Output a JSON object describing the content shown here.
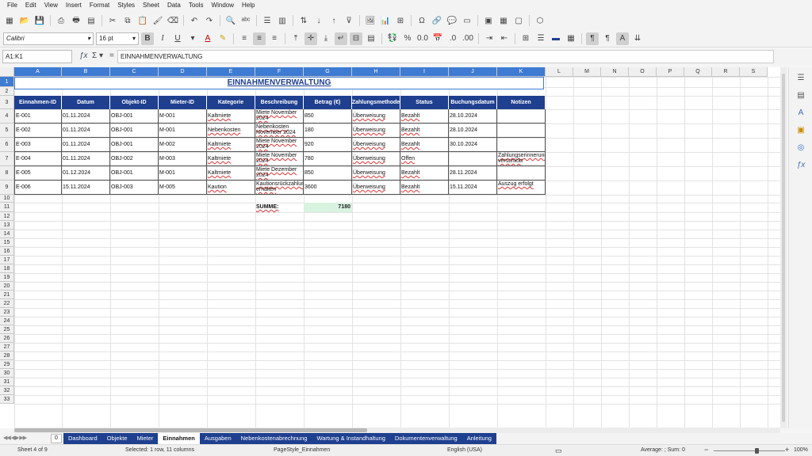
{
  "menu": [
    "File",
    "Edit",
    "View",
    "Insert",
    "Format",
    "Styles",
    "Sheet",
    "Data",
    "Tools",
    "Window",
    "Help"
  ],
  "toolbar": {
    "font_name": "Calibri",
    "font_size": "16 pt"
  },
  "formula_bar": {
    "name_box": "A1:K1",
    "content": "EINNAHMENVERWALTUNG"
  },
  "columns": [
    "A",
    "B",
    "C",
    "D",
    "E",
    "F",
    "G",
    "H",
    "I",
    "J",
    "K",
    "L",
    "M",
    "N",
    "O",
    "P",
    "Q",
    "R",
    "S"
  ],
  "rows": [
    "1",
    "2",
    "3",
    "4",
    "5",
    "6",
    "7",
    "8",
    "9",
    "10",
    "11",
    "12",
    "13",
    "14",
    "15",
    "16",
    "17",
    "18",
    "19",
    "20",
    "21",
    "22",
    "23",
    "24",
    "25",
    "26",
    "27",
    "28",
    "29",
    "30",
    "31",
    "32",
    "33"
  ],
  "sheet": {
    "title": "EINNAHMENVERWALTUNG",
    "headers": [
      "Einnahmen-ID",
      "Datum",
      "Objekt-ID",
      "Mieter-ID",
      "Kategorie",
      "Beschreibung",
      "Betrag (€)",
      "Zahlungsmethode",
      "Status",
      "Buchungsdatum",
      "Notizen"
    ],
    "rows": [
      [
        "E-001",
        "01.11.2024",
        "OBJ-001",
        "M-001",
        "Kaltmiete",
        "Miete November 2024",
        "850",
        "Überweisung",
        "Bezahlt",
        "28.10.2024",
        ""
      ],
      [
        "E-002",
        "01.11.2024",
        "OBJ-001",
        "M-001",
        "Nebenkosten",
        "Nebenkosten November 2024",
        "180",
        "Überweisung",
        "Bezahlt",
        "28.10.2024",
        ""
      ],
      [
        "E-003",
        "01.11.2024",
        "OBJ-001",
        "M-002",
        "Kaltmiete",
        "Miete November 2024",
        "920",
        "Überweisung",
        "Bezahlt",
        "30.10.2024",
        ""
      ],
      [
        "E-004",
        "01.11.2024",
        "OBJ-002",
        "M-003",
        "Kaltmiete",
        "Miete November 2024",
        "780",
        "Überweisung",
        "Offen",
        "",
        "Zahlungserinnerung verschickt"
      ],
      [
        "E-005",
        "01.12.2024",
        "OBJ-001",
        "M-001",
        "Kaltmiete",
        "Miete Dezember 2024",
        "850",
        "Überweisung",
        "Bezahlt",
        "28.11.2024",
        ""
      ],
      [
        "E-006",
        "15.11.2024",
        "OBJ-003",
        "M-005",
        "Kaution",
        "Kautionsrückzahlung erhalten",
        "3600",
        "Überweisung",
        "Bezahlt",
        "15.11.2024",
        "Auszug erfolgt"
      ]
    ],
    "sum_label": "SUMME:",
    "sum_value": "7180"
  },
  "tabs": {
    "add_label": "0",
    "items": [
      "Dashboard",
      "Objekte",
      "Mieter",
      "Einnahmen",
      "Ausgaben",
      "Nebenkostenabrechnung",
      "Wartung & Instandhaltung",
      "Dokumentenverwaltung",
      "Anleitung"
    ],
    "active": "Einnahmen"
  },
  "status": {
    "sheet": "Sheet 4 of 9",
    "selection": "Selected: 1 row, 11 columns",
    "page_style": "PageStyle_Einnahmen",
    "language": "English (USA)",
    "summary": "Average: ; Sum: 0",
    "zoom": "100%"
  }
}
